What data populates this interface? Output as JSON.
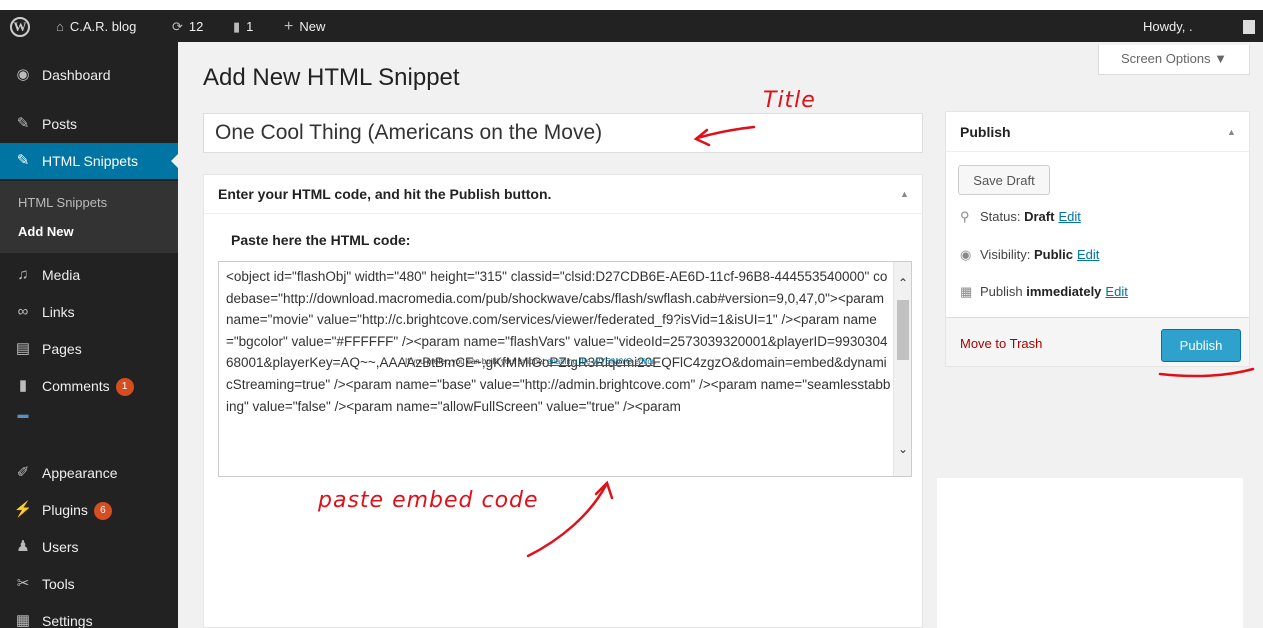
{
  "adminbar": {
    "site_name": "C.A.R. blog",
    "updates_count": "12",
    "comments_count": "1",
    "new_label": "New",
    "howdy": "Howdy, ."
  },
  "sidebar": {
    "items": [
      {
        "label": "Dashboard",
        "icon": "dashboard-icon"
      },
      {
        "label": "Posts",
        "icon": "pin-icon"
      },
      {
        "label": "HTML Snippets",
        "icon": "pin-icon"
      },
      {
        "label": "Media",
        "icon": "media-icon"
      },
      {
        "label": "Links",
        "icon": "link-icon"
      },
      {
        "label": "Pages",
        "icon": "pages-icon"
      },
      {
        "label": "Comments",
        "icon": "comment-icon",
        "badge": "1"
      },
      {
        "label": "Appearance",
        "icon": "brush-icon"
      },
      {
        "label": "Plugins",
        "icon": "plug-icon",
        "badge": "6"
      },
      {
        "label": "Users",
        "icon": "user-icon"
      },
      {
        "label": "Tools",
        "icon": "wrench-icon"
      },
      {
        "label": "Settings",
        "icon": "settings-icon"
      }
    ],
    "submenu": [
      "HTML Snippets",
      "Add New"
    ]
  },
  "screen_options": "Screen Options ▼",
  "page_title": "Add New HTML Snippet",
  "title_value": "One Cool Thing (Americans on the Move)",
  "code_box": {
    "title": "Enter your HTML code, and hit the Publish button.",
    "label": "Paste here the HTML code:",
    "code": "<object id=\"flashObj\" width=\"480\" height=\"315\" classid=\"clsid:D27CDB6E-AE6D-11cf-96B8-444553540000\" codebase=\"http://download.macromedia.com/pub/shockwave/cabs/flash/swflash.cab#version=9,0,47,0\"><param name=\"movie\" value=\"http://c.brightcove.com/services/viewer/federated_f9?isVid=1&isUI=1\" /><param name=\"bgcolor\" value=\"#FFFFFF\" /><param name=\"flashVars\" value=\"videoId=2573039320001&playerID=993030468001&playerKey=AQ~~,AAAAzBtBmCE~,gKfMMlGoPZtgR3Rlqemi20EQFlC4zgzO&domain=embed&dynamicStreaming=true\" /><param name=\"base\" value=\"http://admin.brightcove.com\" /><param name=\"seamlesstabbing\" value=\"false\" /><param name=\"allowFullScreen\" value=\"true\" /><param"
  },
  "wysiwyg_note": {
    "prefix": "If you prefer, you can build your snippet ",
    "link": "enabling the WYSIWYG editor",
    "suffix": "."
  },
  "publish": {
    "title": "Publish",
    "save_draft": "Save Draft",
    "status_label": "Status:",
    "status_value": "Draft",
    "visibility_label": "Visibility:",
    "visibility_value": "Public",
    "publish_label": "Publish",
    "publish_value": "immediately",
    "edit": "Edit",
    "move_to_trash": "Move to Trash",
    "publish_button": "Publish"
  },
  "annotations": {
    "title_note": "Title",
    "paste_note": "paste embed code"
  },
  "colors": {
    "adminbar_bg": "#222222",
    "sidebar_active": "#0074a2",
    "publish_button": "#2ea2cc",
    "annotation": "#e0101a"
  }
}
